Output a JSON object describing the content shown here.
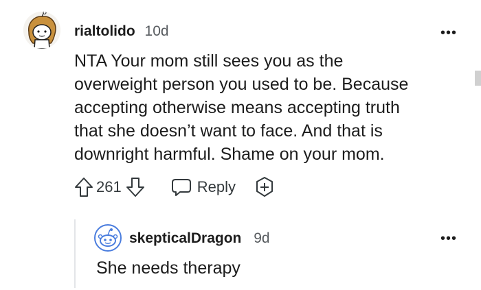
{
  "comment": {
    "username": "rialtolido",
    "age": "10d",
    "more_label": "•••",
    "body": "NTA Your mom still sees you as the\noverweight person you used to be. Because\naccepting otherwise means accepting truth\nthat she doesn’t want to face. And that is\ndownright harmful. Shame on your mom.",
    "score": "261",
    "reply_label": "Reply",
    "avatar_icon": "snoo-avatar-icon"
  },
  "reply": {
    "username": "skepticalDragon",
    "age": "9d",
    "more_label": "•••",
    "body": "She needs therapy",
    "avatar_icon": "default-snoo-avatar-icon"
  },
  "colors": {
    "text": "#1c1c1c",
    "meta": "#575b5f",
    "icon": "#33393c",
    "thread_line": "#e3e5e8",
    "avatar_blue": "#4a7dde"
  }
}
